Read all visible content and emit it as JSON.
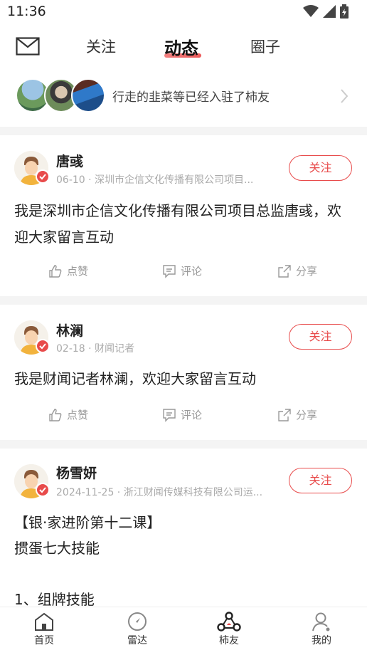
{
  "status": {
    "time": "11:36"
  },
  "tabs": {
    "follow": "关注",
    "feed": "动态",
    "circle": "圈子"
  },
  "banner": {
    "text": "行走的韭菜等已经入驻了柿友"
  },
  "posts": [
    {
      "name": "唐彧",
      "meta": "06-10 · 深圳市企信文化传播有限公司项目...",
      "follow": "关注",
      "content": "我是深圳市企信文化传播有限公司项目总监唐彧，欢迎大家留言互动",
      "like": "点赞",
      "comment": "评论",
      "share": "分享"
    },
    {
      "name": "林澜",
      "meta": "02-18 · 财闻记者",
      "follow": "关注",
      "content": "我是财闻记者林澜，欢迎大家留言互动",
      "like": "点赞",
      "comment": "评论",
      "share": "分享"
    },
    {
      "name": "杨雪妍",
      "meta": "2024-11-25 · 浙江财闻传媒科技有限公司运...",
      "follow": "关注",
      "content_line1": "【银·家进阶第十二课】",
      "content_line2": "掼蛋七大技能",
      "content_line3": "1、组牌技能"
    }
  ],
  "bottom_nav": {
    "home": "首页",
    "radar": "雷达",
    "friends": "柿友",
    "mine": "我的"
  },
  "colors": {
    "accent": "#e84b4b"
  }
}
